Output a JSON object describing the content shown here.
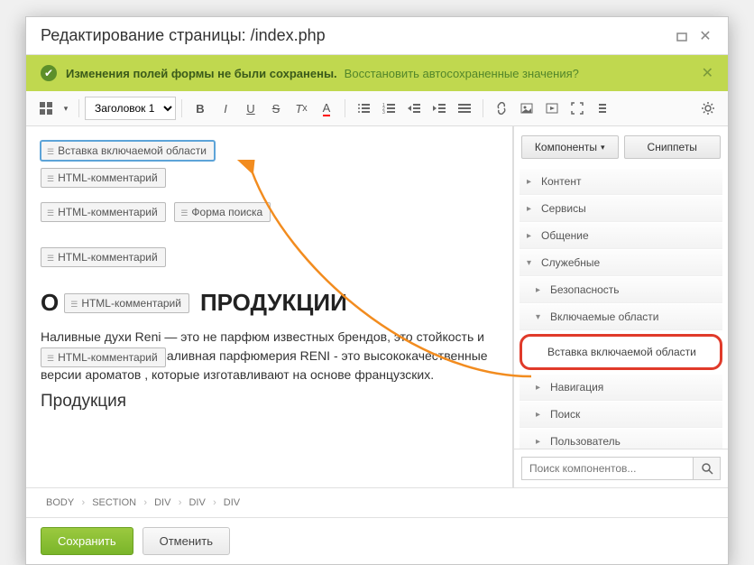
{
  "title": "Редактирование страницы: /index.php",
  "alert": {
    "bold": "Изменения полей формы не были сохранены.",
    "link": "Восстановить автосохраненные значения?"
  },
  "format_select": "Заголовок 1",
  "editor": {
    "tag_include_area": "Вставка включаемой области",
    "tag_html_comment": "HTML-комментарий",
    "tag_search_form": "Форма поиска",
    "h1_prefix": "О",
    "h1_suffix": "ПРОДУКЦИИ",
    "paragraph": "Наливные духи Reni — это не парфюм известных брендов, это стойкость и стойкость аромата. Наливная парфюмерия RENI - это высококачественные версии ароматов , которые изготавливают на основе французских.",
    "h2": "Продукция"
  },
  "sidebar": {
    "tab_components": "Компоненты",
    "tab_snippets": "Сниппеты",
    "items": [
      {
        "label": "Контент",
        "expanded": false
      },
      {
        "label": "Сервисы",
        "expanded": false
      },
      {
        "label": "Общение",
        "expanded": false
      },
      {
        "label": "Служебные",
        "expanded": true
      }
    ],
    "sub_items": [
      {
        "label": "Безопасность"
      },
      {
        "label": "Включаемые области"
      }
    ],
    "highlighted_leaf": "Вставка включаемой области",
    "more_items": [
      {
        "label": "Навигация"
      },
      {
        "label": "Поиск"
      },
      {
        "label": "Пользователь"
      }
    ],
    "search_placeholder": "Поиск компонентов..."
  },
  "breadcrumbs": [
    "BODY",
    "SECTION",
    "DIV",
    "DIV",
    "DIV"
  ],
  "buttons": {
    "save": "Сохранить",
    "cancel": "Отменить"
  }
}
